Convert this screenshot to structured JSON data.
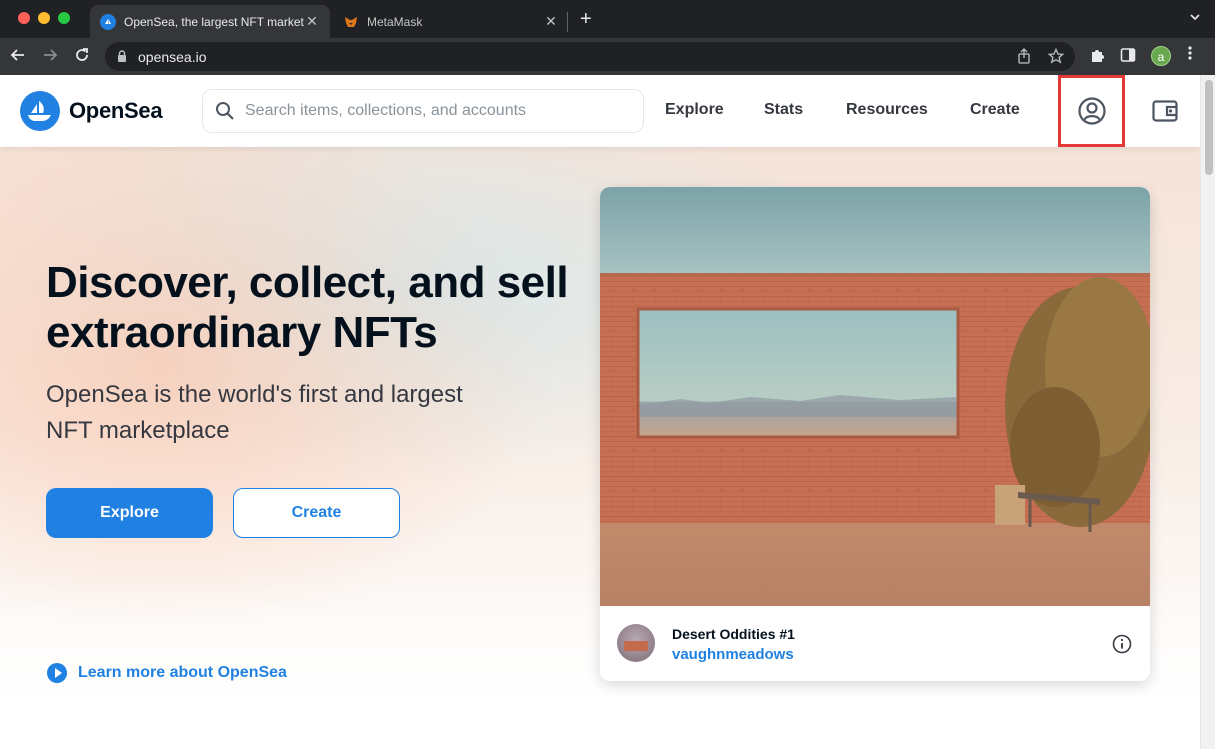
{
  "browser": {
    "tabs": [
      {
        "title": "OpenSea, the largest NFT marketplace",
        "active": true,
        "favicon": "opensea-favicon",
        "close": "✕"
      },
      {
        "title": "MetaMask",
        "active": false,
        "favicon": "metamask-favicon",
        "close": "✕"
      }
    ],
    "new_tab": "+",
    "url": "opensea.io",
    "profile_initial": "a"
  },
  "header": {
    "brand": "OpenSea",
    "search": {
      "placeholder": "Search items, collections, and accounts",
      "value": ""
    },
    "nav": [
      {
        "label": "Explore"
      },
      {
        "label": "Stats"
      },
      {
        "label": "Resources"
      },
      {
        "label": "Create"
      }
    ],
    "account_icon": "account-circle-icon",
    "wallet_icon": "wallet-icon"
  },
  "hero": {
    "headline": "Discover, collect, and sell extraordinary NFTs",
    "subline": "OpenSea is the world's first and largest NFT marketplace",
    "buttons": {
      "explore": "Explore",
      "create": "Create"
    },
    "learn_more": "Learn more about OpenSea"
  },
  "featured": {
    "title": "Desert Oddities #1",
    "creator": "vaughnmeadows",
    "info_icon": "info-icon"
  },
  "colors": {
    "accent": "#2081e2",
    "heading": "#04111d",
    "highlight_box": "#e53935"
  }
}
